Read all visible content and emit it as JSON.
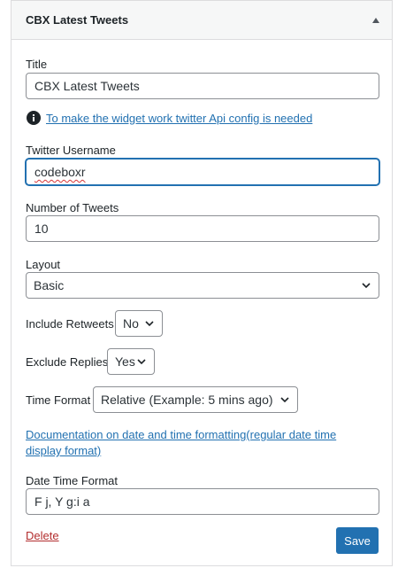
{
  "widget": {
    "title": "CBX Latest Tweets",
    "toggle_icon": "arrow-up-icon"
  },
  "form": {
    "title_label": "Title",
    "title_value": "CBX Latest Tweets",
    "notice_icon": "info-icon",
    "notice_link": "To make the widget work twitter Api config is needed",
    "username_label": "Twitter Username",
    "username_value": "codeboxr",
    "num_tweets_label": "Number of Tweets",
    "num_tweets_value": "10",
    "layout_label": "Layout",
    "layout_value": "Basic",
    "retweets_label": "Include Retweets",
    "retweets_value": "No",
    "replies_label": "Exclude Replies",
    "replies_value": "Yes",
    "time_format_label": "Time Format",
    "time_format_value": "Relative (Example: 5 mins ago)",
    "doc_link_line1": "Documentation on date and time formatting(regular date time",
    "doc_link_line2": "display format)",
    "datetime_label": "Date Time Format",
    "datetime_value": "F j, Y g:i a"
  },
  "actions": {
    "delete_label": "Delete",
    "save_label": "Save"
  },
  "colors": {
    "accent": "#2271b1",
    "delete": "#b32d2e",
    "border": "#8c8f94"
  }
}
